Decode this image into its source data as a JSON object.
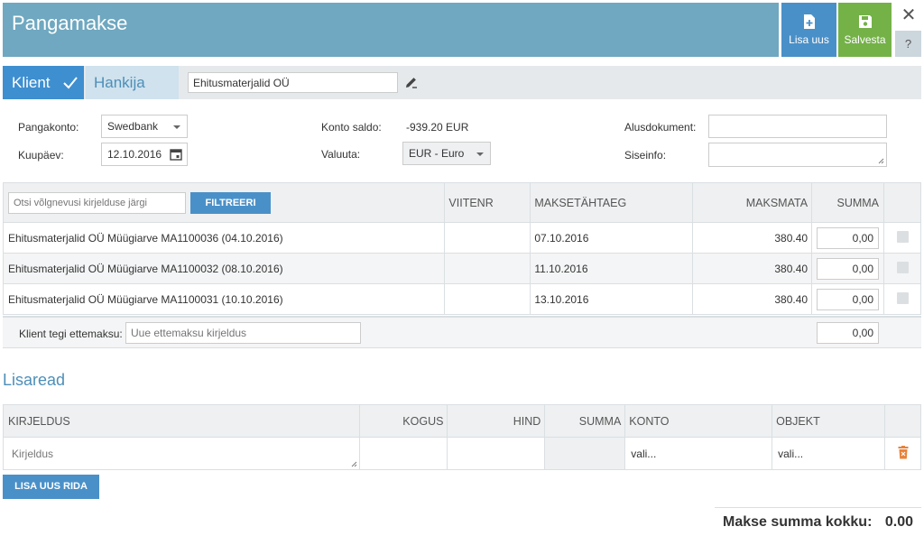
{
  "header": {
    "title": "Pangamakse",
    "add_new_label": "Lisa uus",
    "save_label": "Salvesta",
    "close_label": "✕",
    "help_label": "?"
  },
  "party": {
    "client_tab": "Klient",
    "supplier_tab": "Hankija",
    "client_name": "Ehitusmaterjalid OÜ"
  },
  "form": {
    "bank_account_label": "Pangakonto:",
    "bank_account_value": "Swedbank",
    "date_label": "Kuupäev:",
    "date_value": "12.10.2016",
    "balance_label": "Konto saldo:",
    "balance_value": "-939.20 EUR",
    "currency_label": "Valuuta:",
    "currency_value": "EUR - Euro",
    "base_doc_label": "Alusdokument:",
    "internal_info_label": "Siseinfo:"
  },
  "invoices": {
    "search_placeholder": "Otsi võlgnevusi kirjelduse järgi",
    "filter_label": "FILTREERI",
    "columns": {
      "ref": "VIITENR",
      "due": "MAKSETÄHTAEG",
      "unpaid": "MAKSMATA",
      "sum": "SUMMA"
    },
    "rows": [
      {
        "description": "Ehitusmaterjalid OÜ Müügiarve MA1100036 (04.10.2016)",
        "ref": "",
        "due": "07.10.2016",
        "unpaid": "380.40",
        "sum": "0,00"
      },
      {
        "description": "Ehitusmaterjalid OÜ Müügiarve MA1100032 (08.10.2016)",
        "ref": "",
        "due": "11.10.2016",
        "unpaid": "380.40",
        "sum": "0,00"
      },
      {
        "description": "Ehitusmaterjalid OÜ Müügiarve MA1100031 (10.10.2016)",
        "ref": "",
        "due": "13.10.2016",
        "unpaid": "380.40",
        "sum": "0,00"
      }
    ],
    "prepay_label": "Klient tegi ettemaksu:",
    "prepay_placeholder": "Uue ettemaksu kirjeldus",
    "prepay_sum": "0,00"
  },
  "extra": {
    "title": "Lisaread",
    "columns": {
      "description": "KIRJELDUS",
      "quantity": "KOGUS",
      "price": "HIND",
      "sum": "SUMMA",
      "account": "KONTO",
      "object": "OBJEKT"
    },
    "row": {
      "description_placeholder": "Kirjeldus",
      "account": "vali...",
      "object": "vali..."
    },
    "add_row_label": "LISA UUS RIDA"
  },
  "totals": {
    "label": "Makse summa kokku:",
    "value": "0.00"
  },
  "colors": {
    "header": "#6fa8c0",
    "primary": "#4a90c8",
    "save": "#74b248",
    "delete": "#e8833a"
  }
}
